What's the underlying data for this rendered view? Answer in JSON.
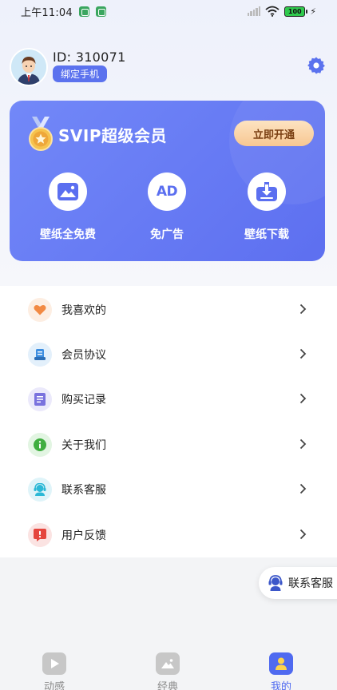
{
  "status_bar": {
    "time": "上午11:04",
    "battery": "100"
  },
  "profile": {
    "user_id": "ID: 310071",
    "bind_button": "绑定手机"
  },
  "svip": {
    "title": "SVIP超级会员",
    "open_button": "立即开通",
    "benefits": [
      {
        "label": "壁纸全免费",
        "icon": "mountain-image-icon"
      },
      {
        "label": "免广告",
        "icon_text": "AD",
        "icon": "ad-icon"
      },
      {
        "label": "壁纸下载",
        "icon": "download-tray-icon"
      }
    ]
  },
  "menu": {
    "items": [
      {
        "label": "我喜欢的",
        "icon": "heart-icon",
        "color": "#f28a43",
        "bg": "#fdeee2"
      },
      {
        "label": "会员协议",
        "icon": "member-document-icon",
        "color": "#3d8ee0",
        "bg": "#e3f0fb"
      },
      {
        "label": "购买记录",
        "icon": "list-record-icon",
        "color": "#7a72de",
        "bg": "#ebe9fb"
      },
      {
        "label": "关于我们",
        "icon": "info-icon",
        "color": "#3fae3f",
        "bg": "#e2f5e2"
      },
      {
        "label": "联系客服",
        "icon": "customer-service-icon",
        "color": "#2bb8d6",
        "bg": "#dff4f9"
      },
      {
        "label": "用户反馈",
        "icon": "feedback-icon",
        "color": "#e5453d",
        "bg": "#fbe3e2"
      }
    ]
  },
  "float_service": {
    "label": "联系客服",
    "icon": "customer-service-icon"
  },
  "bottom_nav": {
    "tabs": [
      {
        "label": "动感",
        "icon": "play-icon",
        "active": false
      },
      {
        "label": "经典",
        "icon": "image-icon",
        "active": false
      },
      {
        "label": "我的",
        "icon": "user-icon",
        "active": true
      }
    ]
  },
  "colors": {
    "accent": "#5b72ee",
    "active_tab": "#4f6af0",
    "inactive_tab": "#8a8a8a"
  }
}
